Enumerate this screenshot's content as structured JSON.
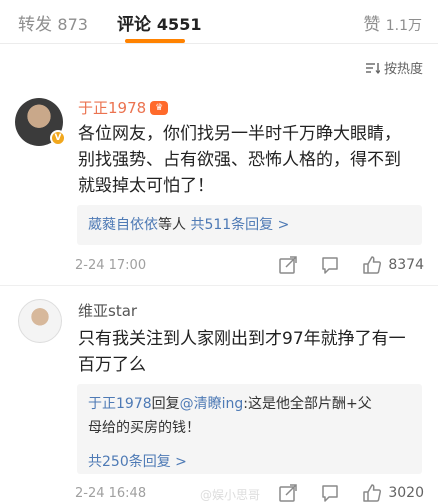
{
  "tabs": {
    "repost": {
      "label": "转发",
      "count": "873"
    },
    "comment": {
      "label": "评论",
      "count": "4551"
    },
    "like": {
      "label": "赞",
      "count": "1.1万"
    }
  },
  "sort": {
    "label": "按热度",
    "icon": "sort-lines-icon"
  },
  "comments": [
    {
      "username": "于正1978",
      "verified_icon": "verified-v-icon",
      "vip_icon": "vip-crown-icon",
      "text_lines": [
        "各位网友，你们找另一半时千万睁大眼睛，",
        "别找强势、占有欲强、恐怖人格的，得不到",
        "就毁掉太可怕了！"
      ],
      "replies": {
        "names": "葳蕤自依依",
        "suffix": "等人",
        "link": "共511条回复 >"
      },
      "time": "2-24 17:00",
      "likes": "8374"
    },
    {
      "username": "维亚star",
      "text_lines": [
        "只有我关注到人家刚出到才97年就挣了有一",
        "百万了么"
      ],
      "replies": {
        "author": "于正1978",
        "verb": "回复",
        "mention": "@清瞭ing",
        "text_line1": ":这是他全部片酬+父",
        "text_line2": "母给的买房的钱！",
        "link": "共250条回复 >"
      },
      "time": "2-24 16:48",
      "likes": "3020"
    }
  ],
  "watermark": "@娱小思哥"
}
